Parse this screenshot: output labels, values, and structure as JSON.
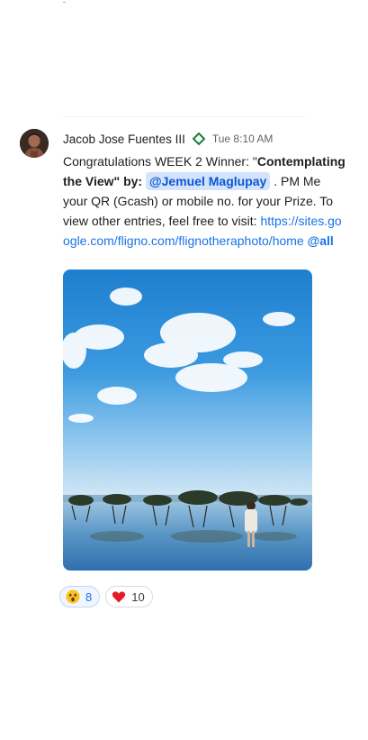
{
  "message": {
    "sender": "Jacob Jose Fuentes III",
    "timestamp": "Tue 8:10 AM",
    "text_part1": "Congratulations WEEK 2 Winner: \"",
    "text_bold": "Contemplating the View\" by:",
    "mention": "@Jemuel Maglupay",
    "text_part2": "  .  PM Me your QR (Gcash) or mobile no. for your Prize. To view other entries, feel free to visit: ",
    "link": "https://sites.google.com/fligno.com/flignotheraphoto/home",
    "mention_all": "@all"
  },
  "attachment": {
    "type": "photo",
    "alt": "photo"
  },
  "reactions": [
    {
      "emoji": "astonished-face",
      "count": "8",
      "reacted_by_me": true
    },
    {
      "emoji": "red-heart",
      "count": "10",
      "reacted_by_me": false
    }
  ],
  "colors": {
    "link": "#1a73e8",
    "mention_bg": "#d3e3fd",
    "verified": "#188038"
  }
}
